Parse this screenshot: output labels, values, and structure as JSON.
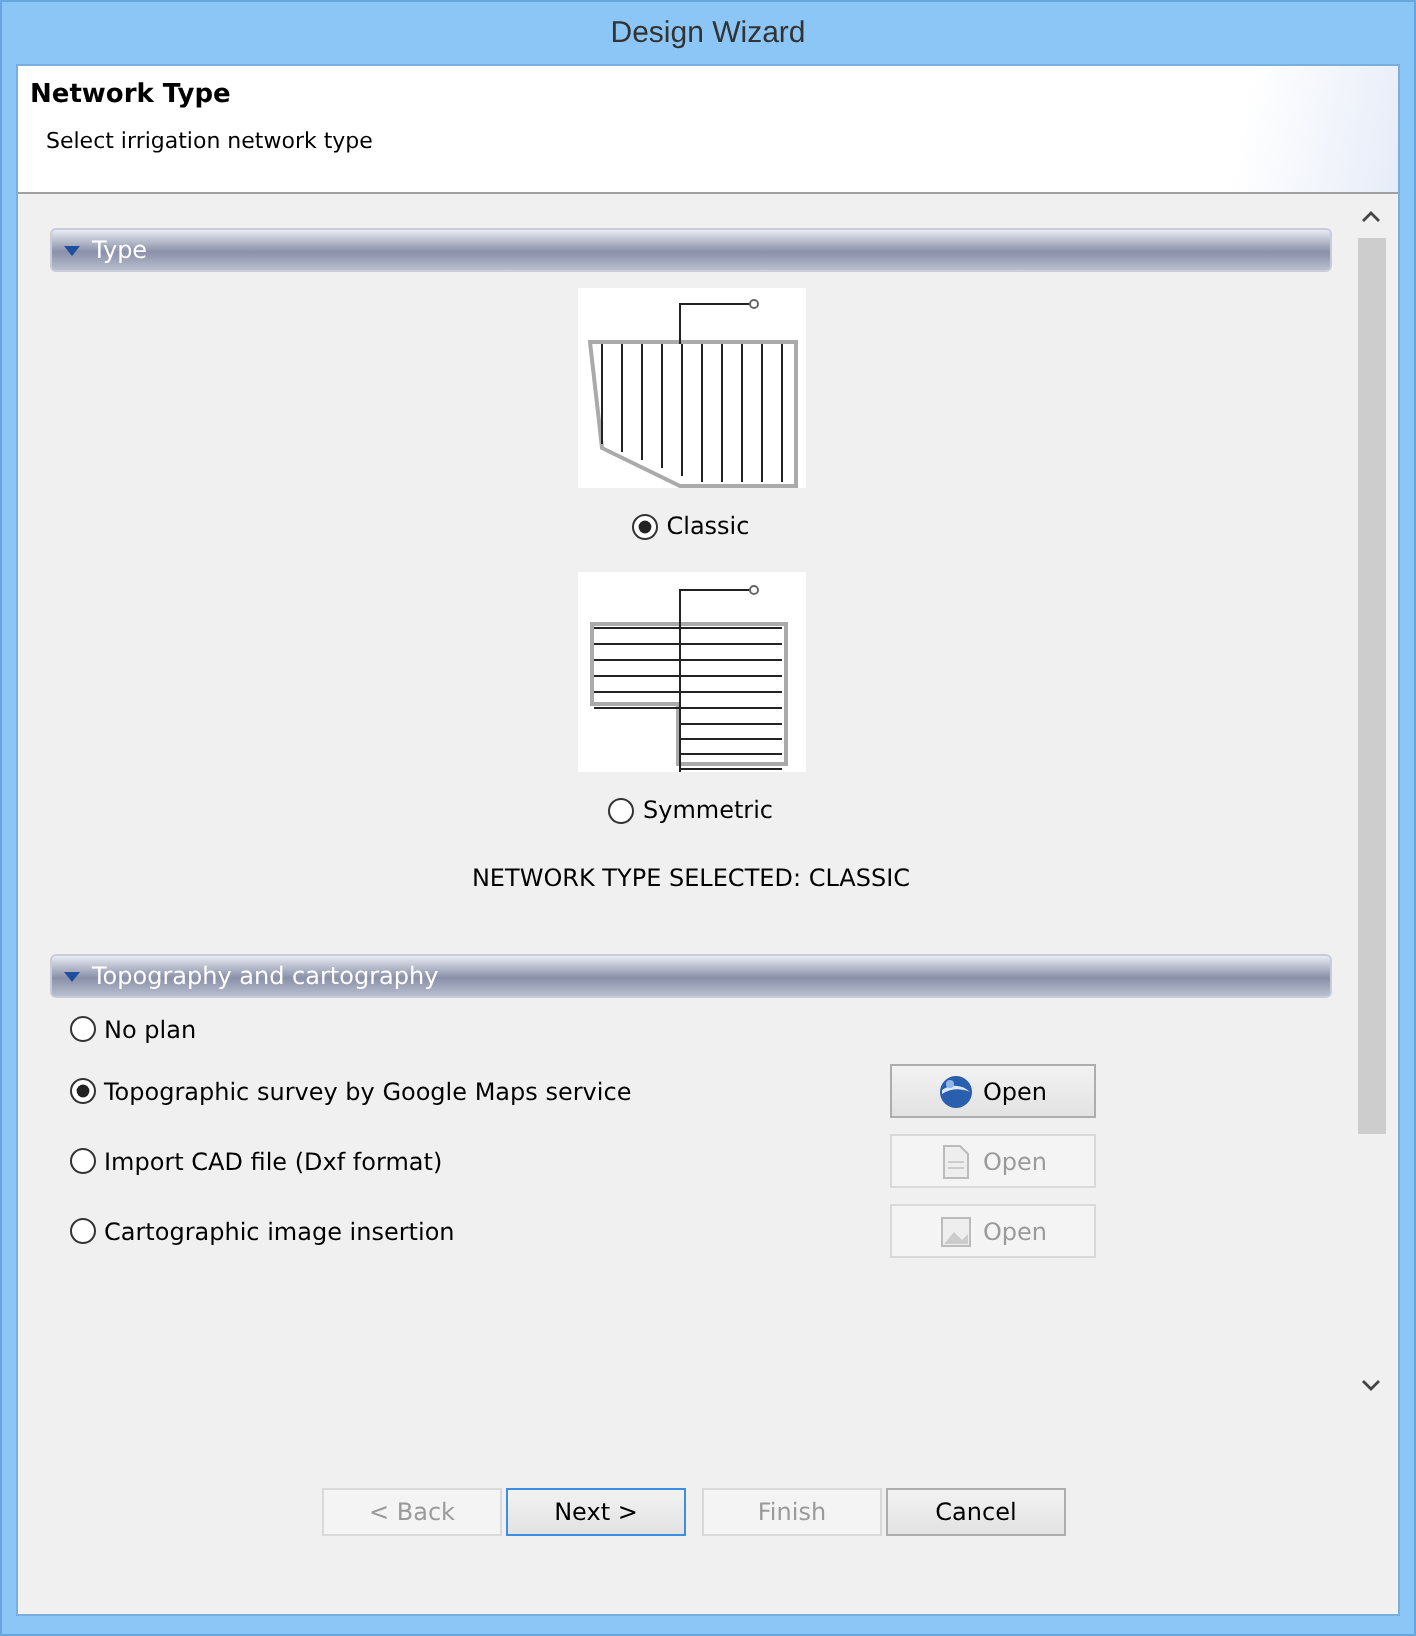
{
  "window": {
    "title": "Design Wizard"
  },
  "header": {
    "title": "Network Type",
    "subtitle": "Select irrigation network type"
  },
  "type_section": {
    "title": "Type",
    "expanded": true,
    "options": [
      {
        "kind": "classic",
        "label": "Classic",
        "selected": true
      },
      {
        "kind": "symmetric",
        "label": "Symmetric",
        "selected": false
      }
    ],
    "status": "NETWORK TYPE SELECTED: CLASSIC"
  },
  "topography_section": {
    "title": "Topography and cartography",
    "expanded": true,
    "options": [
      {
        "label": "No plan",
        "selected": false
      },
      {
        "label": "Topographic survey by Google Maps service",
        "selected": true,
        "button": {
          "kind": "globe",
          "label": "Open",
          "disabled": false
        }
      },
      {
        "label": "Import CAD file (Dxf format)",
        "selected": false,
        "button": {
          "kind": "cad",
          "label": "Open",
          "disabled": true
        }
      },
      {
        "label": "Cartographic image insertion",
        "selected": false,
        "button": {
          "kind": "image",
          "label": "Open",
          "disabled": true
        }
      }
    ]
  },
  "buttons": [
    {
      "label": "< Back",
      "disabled": true,
      "focused": false
    },
    {
      "label": "Next >",
      "disabled": false,
      "focused": true
    },
    {
      "label": "Finish",
      "disabled": true,
      "focused": false
    },
    {
      "label": "Cancel",
      "disabled": false,
      "focused": false
    }
  ]
}
